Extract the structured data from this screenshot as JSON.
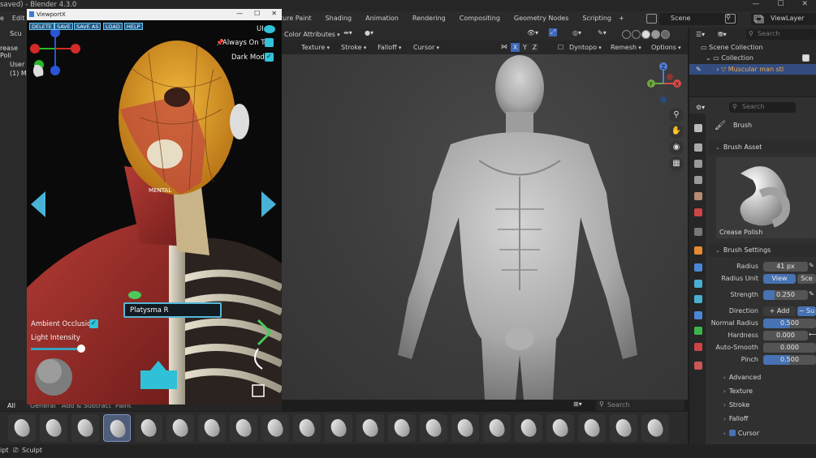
{
  "window": {
    "title_text": "saved) - Blender 4.3.0",
    "min": "—",
    "max": "☐",
    "close": "✕"
  },
  "menubar": {
    "left": [
      "e",
      "Edit"
    ],
    "tabs": [
      "ture Paint",
      "Shading",
      "Animation",
      "Rendering",
      "Compositing",
      "Geometry Nodes",
      "Scripting",
      "+"
    ],
    "scene": "Scene",
    "view_layer": "ViewLayer"
  },
  "left_strip": {
    "mode": "Scu",
    "brush": "rease Poli",
    "user": "User",
    "coll": "(1) M"
  },
  "viewport": {
    "header1": {
      "color_attributes": "Color Attributes"
    },
    "header2": {
      "texture": "Texture",
      "stroke": "Stroke",
      "falloff": "Falloff",
      "cursor": "Cursor",
      "x": "X",
      "y": "Y",
      "z": "Z",
      "dyntopo": "Dyntopo",
      "remesh": "Remesh",
      "options": "Options"
    },
    "gizmo": {
      "x": "X",
      "y": "Y",
      "z": "Z"
    },
    "search_placeholder": "Search"
  },
  "brush_tabs": [
    "All",
    "General",
    "Add & Subtract",
    "Paint"
  ],
  "status": {
    "left": "ipt",
    "mode": "Sculpt"
  },
  "viewportx": {
    "title": "ViewportX",
    "buttons": [
      "DELETE",
      "SAVE",
      "SAVE AS",
      "LOAD",
      "HELP"
    ],
    "ui_label": "UI",
    "always_on_top": "Always On Top",
    "dark_mode": "Dark Mode",
    "ambient_occlusion": "Ambient Occlusion",
    "light_intensity": "Light Intensity",
    "light_intensity_level": 0.85,
    "selected_muscle": "Platysma R",
    "mental_label": "MENTAL",
    "check": "✓"
  },
  "outliner": {
    "search_placeholder": "Search",
    "rows": [
      "Scene Collection",
      "Collection",
      "Muscular man stl"
    ]
  },
  "properties": {
    "search_placeholder": "Search",
    "brush_title": "Brush",
    "brush_asset_header": "Brush Asset",
    "brush_name": "Crease Polish",
    "brush_settings_header": "Brush Settings",
    "radius_label": "Radius",
    "radius_value": "41 px",
    "radius_unit_label": "Radius Unit",
    "radius_unit_view": "View",
    "radius_unit_scene": "Sce",
    "strength_label": "Strength",
    "strength_value": "0.250",
    "strength_level": 0.25,
    "direction_label": "Direction",
    "direction_add": "Add",
    "direction_sub": "Su",
    "normal_radius_label": "Normal Radius",
    "normal_radius_value": "0.500",
    "normal_radius_level": 0.5,
    "hardness_label": "Hardness",
    "hardness_value": "0.000",
    "auto_smooth_label": "Auto-Smooth",
    "auto_smooth_value": "0.000",
    "pinch_label": "Pinch",
    "pinch_value": "0.500",
    "pinch_level": 0.5,
    "subpanels": [
      "Advanced",
      "Texture",
      "Stroke",
      "Falloff",
      "Cursor"
    ]
  }
}
